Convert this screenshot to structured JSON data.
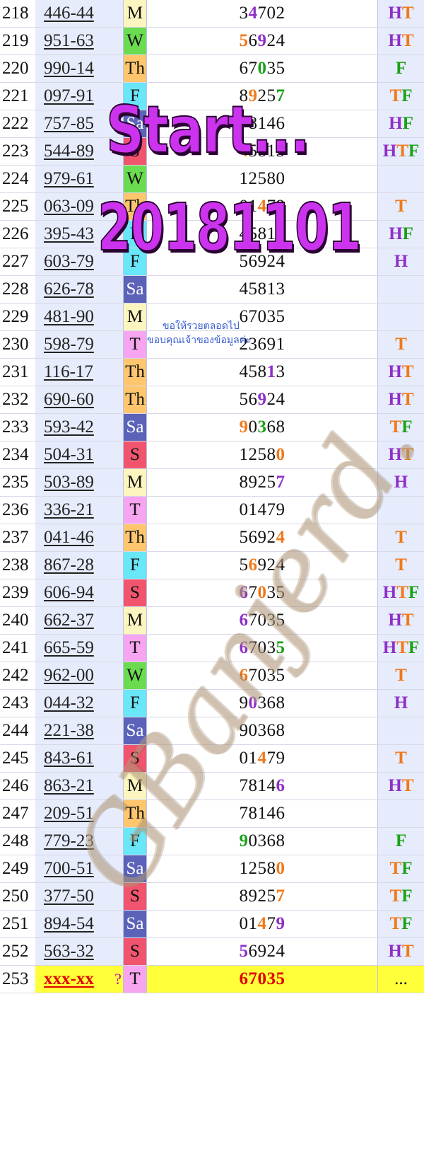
{
  "overlay": {
    "start_text": "Start...",
    "date_text": "20181101",
    "thai_line1": "ขอให้รวยตลอดไป",
    "thai_line2": "ขอบคุณเจ้าของข้อมูลค่ะ",
    "watermark_text": "GBanjerd."
  },
  "colors": {
    "H": "#8e2fc8",
    "T": "#f07818",
    "F": "#1aa018",
    "highlight": "#ffff3a",
    "purple_digit": "#8e2fc8",
    "orange_digit": "#f07818",
    "green_digit": "#1aa018"
  },
  "rows": [
    {
      "no": "218",
      "code": "446-44",
      "day": "M",
      "digits": [
        "3",
        "4",
        "7",
        "0",
        "2"
      ],
      "dc": [
        "",
        "p",
        "",
        "",
        ""
      ],
      "res": "HT"
    },
    {
      "no": "219",
      "code": "951-63",
      "day": "W",
      "digits": [
        "5",
        "6",
        "9",
        "2",
        "4"
      ],
      "dc": [
        "o",
        "",
        "p",
        "",
        ""
      ],
      "res": "HT"
    },
    {
      "no": "220",
      "code": "990-14",
      "day": "Th",
      "digits": [
        "6",
        "7",
        "0",
        "3",
        "5"
      ],
      "dc": [
        "",
        "",
        "g",
        "",
        ""
      ],
      "res": "F"
    },
    {
      "no": "221",
      "code": "097-91",
      "day": "F",
      "digits": [
        "8",
        "9",
        "2",
        "5",
        "7"
      ],
      "dc": [
        "",
        "o",
        "",
        "",
        "g"
      ],
      "res": "TF"
    },
    {
      "no": "222",
      "code": "757-85",
      "day": "Sa",
      "digits": [
        "7",
        "8",
        "1",
        "4",
        "6"
      ],
      "dc": [
        "",
        "",
        "",
        "",
        ""
      ],
      "res": "HF"
    },
    {
      "no": "223",
      "code": "544-89",
      "day": "S",
      "digits": [
        "4",
        "5",
        "8",
        "1",
        "3"
      ],
      "dc": [
        "o",
        "",
        "",
        "",
        ""
      ],
      "res": "HTF"
    },
    {
      "no": "224",
      "code": "979-61",
      "day": "W",
      "digits": [
        "1",
        "2",
        "5",
        "8",
        "0"
      ],
      "dc": [
        "",
        "",
        "",
        "",
        ""
      ],
      "res": ""
    },
    {
      "no": "225",
      "code": "063-09",
      "day": "Th",
      "digits": [
        "0",
        "1",
        "4",
        "7",
        "9"
      ],
      "dc": [
        "",
        "",
        "o",
        "",
        ""
      ],
      "res": "T"
    },
    {
      "no": "226",
      "code": "395-43",
      "day": "F",
      "digits": [
        "4",
        "5",
        "8",
        "1",
        "3"
      ],
      "dc": [
        "",
        "",
        "",
        "",
        "p"
      ],
      "res": "HF"
    },
    {
      "no": "227",
      "code": "603-79",
      "day": "F",
      "digits": [
        "5",
        "6",
        "9",
        "2",
        "4"
      ],
      "dc": [
        "",
        "",
        "",
        "",
        ""
      ],
      "res": "H"
    },
    {
      "no": "228",
      "code": "626-78",
      "day": "Sa",
      "digits": [
        "4",
        "5",
        "8",
        "1",
        "3"
      ],
      "dc": [
        "",
        "",
        "",
        "",
        ""
      ],
      "res": ""
    },
    {
      "no": "229",
      "code": "481-90",
      "day": "M",
      "digits": [
        "6",
        "7",
        "0",
        "3",
        "5"
      ],
      "dc": [
        "",
        "",
        "",
        "",
        ""
      ],
      "res": ""
    },
    {
      "no": "230",
      "code": "598-79",
      "day": "T",
      "digits": [
        "2",
        "3",
        "6",
        "9",
        "1"
      ],
      "dc": [
        "",
        "",
        "",
        "",
        ""
      ],
      "res": "T"
    },
    {
      "no": "231",
      "code": "116-17",
      "day": "Th",
      "digits": [
        "4",
        "5",
        "8",
        "1",
        "3"
      ],
      "dc": [
        "",
        "",
        "",
        "p",
        ""
      ],
      "res": "HT"
    },
    {
      "no": "232",
      "code": "690-60",
      "day": "Th",
      "digits": [
        "5",
        "6",
        "9",
        "2",
        "4"
      ],
      "dc": [
        "",
        "",
        "p",
        "",
        ""
      ],
      "res": "HT"
    },
    {
      "no": "233",
      "code": "593-42",
      "day": "Sa",
      "digits": [
        "9",
        "0",
        "3",
        "6",
        "8"
      ],
      "dc": [
        "o",
        "",
        "g",
        "",
        ""
      ],
      "res": "TF"
    },
    {
      "no": "234",
      "code": "504-31",
      "day": "S",
      "digits": [
        "1",
        "2",
        "5",
        "8",
        "0"
      ],
      "dc": [
        "",
        "",
        "",
        "",
        "o"
      ],
      "res": "HT"
    },
    {
      "no": "235",
      "code": "503-89",
      "day": "M",
      "digits": [
        "8",
        "9",
        "2",
        "5",
        "7"
      ],
      "dc": [
        "",
        "",
        "",
        "",
        "p"
      ],
      "res": "H"
    },
    {
      "no": "236",
      "code": "336-21",
      "day": "T",
      "digits": [
        "0",
        "1",
        "4",
        "7",
        "9"
      ],
      "dc": [
        "",
        "",
        "",
        "",
        ""
      ],
      "res": ""
    },
    {
      "no": "237",
      "code": "041-46",
      "day": "Th",
      "digits": [
        "5",
        "6",
        "9",
        "2",
        "4"
      ],
      "dc": [
        "",
        "",
        "",
        "",
        "o"
      ],
      "res": "T"
    },
    {
      "no": "238",
      "code": "867-28",
      "day": "F",
      "digits": [
        "5",
        "6",
        "9",
        "2",
        "4"
      ],
      "dc": [
        "",
        "o",
        "",
        "",
        ""
      ],
      "res": "T"
    },
    {
      "no": "239",
      "code": "606-94",
      "day": "S",
      "digits": [
        "6",
        "7",
        "0",
        "3",
        "5"
      ],
      "dc": [
        "p",
        "",
        "o",
        "",
        ""
      ],
      "res": "HTF"
    },
    {
      "no": "240",
      "code": "662-37",
      "day": "M",
      "digits": [
        "6",
        "7",
        "0",
        "3",
        "5"
      ],
      "dc": [
        "p",
        "",
        "",
        "",
        ""
      ],
      "res": "HT"
    },
    {
      "no": "241",
      "code": "665-59",
      "day": "T",
      "digits": [
        "6",
        "7",
        "0",
        "3",
        "5"
      ],
      "dc": [
        "p",
        "",
        "",
        "",
        "g"
      ],
      "res": "HTF"
    },
    {
      "no": "242",
      "code": "962-00",
      "day": "W",
      "digits": [
        "6",
        "7",
        "0",
        "3",
        "5"
      ],
      "dc": [
        "o",
        "",
        "",
        "",
        ""
      ],
      "res": "T"
    },
    {
      "no": "243",
      "code": "044-32",
      "day": "F",
      "digits": [
        "9",
        "0",
        "3",
        "6",
        "8"
      ],
      "dc": [
        "",
        "p",
        "",
        "",
        ""
      ],
      "res": "H"
    },
    {
      "no": "244",
      "code": "221-38",
      "day": "Sa",
      "digits": [
        "9",
        "0",
        "3",
        "6",
        "8"
      ],
      "dc": [
        "",
        "",
        "",
        "",
        ""
      ],
      "res": ""
    },
    {
      "no": "245",
      "code": "843-61",
      "day": "S",
      "digits": [
        "0",
        "1",
        "4",
        "7",
        "9"
      ],
      "dc": [
        "",
        "",
        "o",
        "",
        ""
      ],
      "res": "T"
    },
    {
      "no": "246",
      "code": "863-21",
      "day": "M",
      "digits": [
        "7",
        "8",
        "1",
        "4",
        "6"
      ],
      "dc": [
        "",
        "",
        "",
        "",
        "p"
      ],
      "res": "HT"
    },
    {
      "no": "247",
      "code": "209-51",
      "day": "Th",
      "digits": [
        "7",
        "8",
        "1",
        "4",
        "6"
      ],
      "dc": [
        "",
        "",
        "",
        "",
        ""
      ],
      "res": ""
    },
    {
      "no": "248",
      "code": "779-23",
      "day": "F",
      "digits": [
        "9",
        "0",
        "3",
        "6",
        "8"
      ],
      "dc": [
        "g",
        "",
        "",
        "",
        ""
      ],
      "res": "F"
    },
    {
      "no": "249",
      "code": "700-51",
      "day": "Sa",
      "digits": [
        "1",
        "2",
        "5",
        "8",
        "0"
      ],
      "dc": [
        "",
        "",
        "",
        "",
        "o"
      ],
      "res": "TF"
    },
    {
      "no": "250",
      "code": "377-50",
      "day": "S",
      "digits": [
        "8",
        "9",
        "2",
        "5",
        "7"
      ],
      "dc": [
        "",
        "",
        "",
        "",
        "o"
      ],
      "res": "TF"
    },
    {
      "no": "251",
      "code": "894-54",
      "day": "Sa",
      "digits": [
        "0",
        "1",
        "4",
        "7",
        "9"
      ],
      "dc": [
        "",
        "",
        "o",
        "",
        "p"
      ],
      "res": "TF"
    },
    {
      "no": "252",
      "code": "563-32",
      "day": "S",
      "digits": [
        "5",
        "6",
        "9",
        "2",
        "4"
      ],
      "dc": [
        "p",
        "",
        "",
        "",
        ""
      ],
      "res": "HT"
    },
    {
      "no": "253",
      "code": "xxx-xx",
      "mark": "?",
      "day": "T",
      "digits": [
        "6",
        "7",
        "0",
        "3",
        "5"
      ],
      "dc": [
        "r",
        "r",
        "r",
        "r",
        "r"
      ],
      "res": "...",
      "hl": true
    }
  ]
}
